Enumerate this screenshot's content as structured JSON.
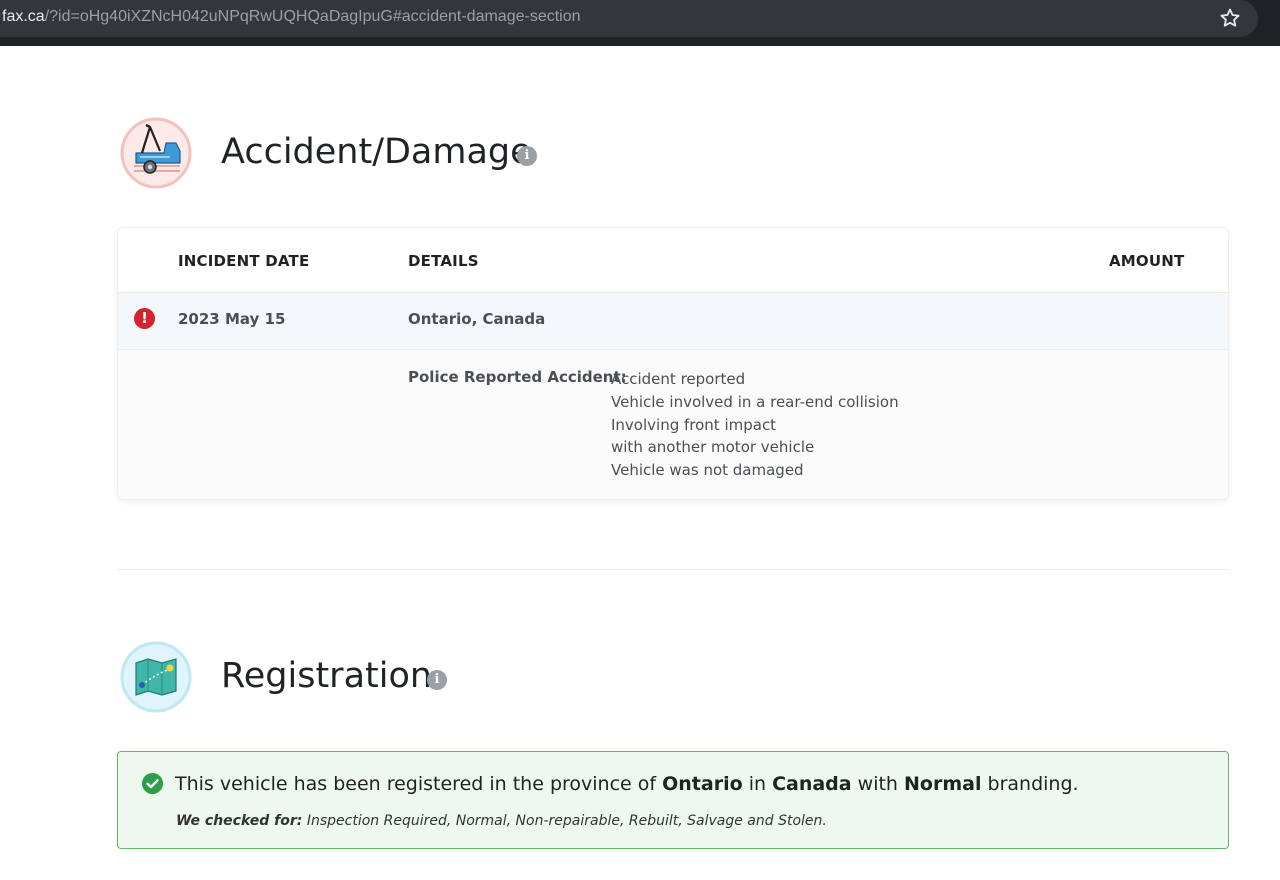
{
  "browser": {
    "url_host": "fax.ca",
    "url_rest": "/?id=oHg40iXZNcH042uNPqRwUQHQaDagIpuG#accident-damage-section",
    "bookmark_icon": "star-icon"
  },
  "accident": {
    "title": "Accident/Damage",
    "icon": "tow-truck-icon",
    "columns": {
      "date": "INCIDENT DATE",
      "details": "DETAILS",
      "amount": "AMOUNT"
    },
    "record": {
      "date": "2023 May 15",
      "location": "Ontario, Canada",
      "detail_label": "Police Reported Accident:",
      "detail_lines": [
        "Accident reported",
        "Vehicle involved in a rear-end collision",
        "Involving front impact",
        "with another motor vehicle",
        "Vehicle was not damaged"
      ]
    },
    "colors": {
      "alert": "#d3232f"
    }
  },
  "registration": {
    "title": "Registration",
    "icon": "map-icon",
    "message": {
      "prefix": "This vehicle has been registered in the province of ",
      "province": "Ontario",
      "mid1": " in ",
      "country": "Canada",
      "mid2": " with ",
      "branding": "Normal",
      "suffix": " branding."
    },
    "checked_label": "We checked for:",
    "checked_list": " Inspection Required, Normal, Non-repairable, Rebuilt, Salvage and Stolen.",
    "colors": {
      "success": "#2e9e4a",
      "box_bg": "#eff8ef",
      "box_border": "#5fb85f"
    }
  }
}
